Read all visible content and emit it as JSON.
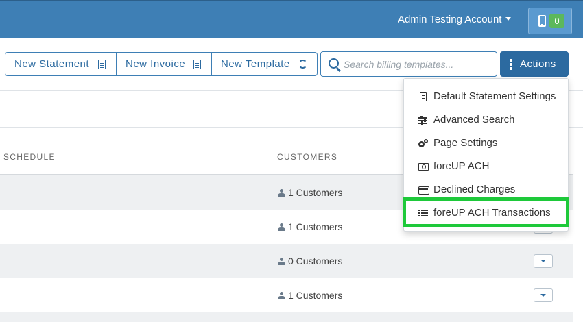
{
  "header": {
    "account_label": "Admin Testing Account",
    "device_count": "0"
  },
  "toolbar": {
    "new_statement_label": "New Statement",
    "new_invoice_label": "New Invoice",
    "new_template_label": "New Template",
    "search_placeholder": "Search billing templates...",
    "actions_label": "Actions"
  },
  "table": {
    "columns": [
      "SCHEDULE",
      "CUSTOMERS"
    ],
    "rows": [
      {
        "customers": "1 Customers"
      },
      {
        "customers": "1 Customers"
      },
      {
        "customers": "0 Customers"
      },
      {
        "customers": "1 Customers"
      }
    ]
  },
  "actions_menu": {
    "items": [
      {
        "label": "Default Statement Settings",
        "icon": "file-text-icon"
      },
      {
        "label": "Advanced Search",
        "icon": "sliders-icon"
      },
      {
        "label": "Page Settings",
        "icon": "cogs-icon"
      },
      {
        "label": "foreUP ACH",
        "icon": "money-bill-icon"
      },
      {
        "label": "Declined Charges",
        "icon": "credit-card-icon"
      },
      {
        "label": "foreUP ACH Transactions",
        "icon": "list-icon"
      }
    ],
    "highlighted_item": "foreUP ACH Transactions"
  },
  "colors": {
    "header_bg": "#3e7fb5",
    "primary": "#2c6aa0",
    "badge": "#5cb85c",
    "highlight": "#1ec93a"
  }
}
